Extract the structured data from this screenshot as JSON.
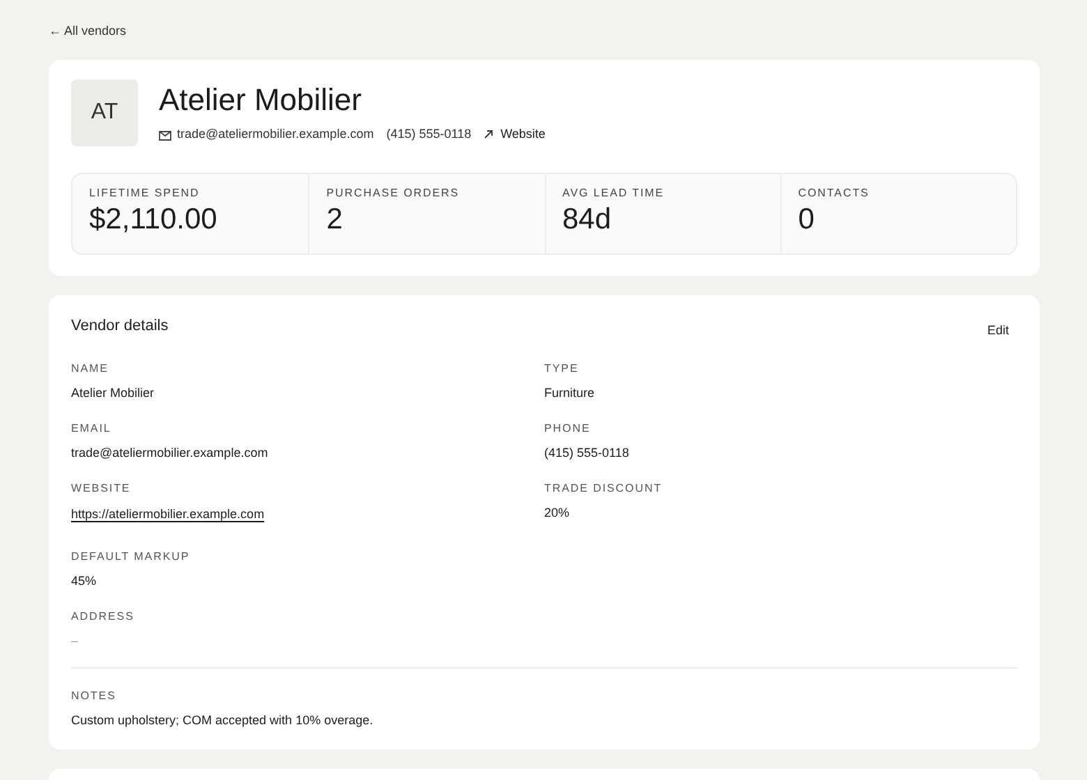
{
  "back_link": "← All vendors",
  "vendor": {
    "initials": "AT",
    "name": "Atelier Mobilier",
    "email": "trade@ateliermobilier.example.com",
    "phone": "(415) 555-0118",
    "website_link": "Website"
  },
  "stats": [
    {
      "label": "LIFETIME SPEND",
      "value": "$2,110.00"
    },
    {
      "label": "PURCHASE ORDERS",
      "value": "2"
    },
    {
      "label": "AVG LEAD TIME",
      "value": "84d"
    },
    {
      "label": "CONTACTS",
      "value": "0"
    }
  ],
  "details": {
    "title": "Vendor details",
    "edit_button": "Edit",
    "columns": [
      [
        {
          "label": "NAME",
          "value": "Atelier Mobilier",
          "kind": "text"
        },
        {
          "label": "EMAIL",
          "value": "trade@ateliermobilier.example.com",
          "kind": "text"
        },
        {
          "label": "WEBSITE",
          "value": "https://ateliermobilier.example.com",
          "kind": "link"
        },
        {
          "label": "DEFAULT MARKUP",
          "value": "45%",
          "kind": "text"
        },
        {
          "label": "ADDRESS",
          "value": "–",
          "kind": "empty"
        }
      ],
      [
        {
          "label": "TYPE",
          "value": "Furniture",
          "kind": "text"
        },
        {
          "label": "PHONE",
          "value": "(415) 555-0118",
          "kind": "text"
        },
        {
          "label": "TRADE DISCOUNT",
          "value": "20%",
          "kind": "text"
        }
      ]
    ],
    "notes": {
      "label": "NOTES",
      "value": "Custom upholstery; COM accepted with 10% overage."
    }
  }
}
